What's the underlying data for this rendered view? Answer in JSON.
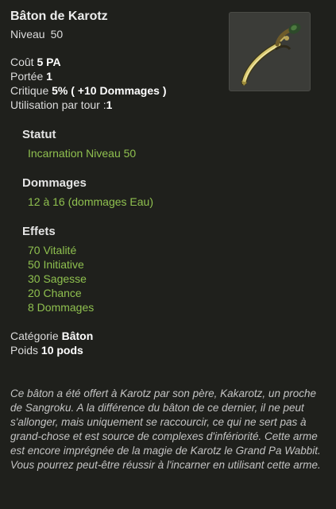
{
  "item": {
    "name": "Bâton de Karotz",
    "level_label": "Niveau",
    "level_value": "50",
    "image_icon": "staff-icon"
  },
  "stats": {
    "cost_label": "Coût",
    "cost_value": "5 PA",
    "range_label": "Portée",
    "range_value": "1",
    "critical_label": "Critique",
    "critical_value": "5% ( +10 Dommages )",
    "uses_label": "Utilisation par tour :",
    "uses_value": "1"
  },
  "status": {
    "title": "Statut",
    "value": "Incarnation Niveau 50"
  },
  "damage": {
    "title": "Dommages",
    "value": "12 à 16 (dommages Eau)"
  },
  "effects": {
    "title": "Effets",
    "items": [
      "70 Vitalité",
      "50 Initiative",
      "30 Sagesse",
      "20 Chance",
      "8 Dommages"
    ]
  },
  "meta": {
    "category_label": "Catégorie",
    "category_value": "Bâton",
    "weight_label": "Poids",
    "weight_value": "10 pods"
  },
  "description": "Ce bâton a été offert à Karotz par son père, Kakarotz, un proche de Sangroku. A la différence du bâton de ce dernier, il ne peut s'allonger, mais uniquement se raccourcir, ce qui ne sert pas à grand-chose et est source de complexes d'infériorité.  Cette arme est encore imprégnée de la magie de Karotz le Grand Pa Wabbit. Vous pourrez peut-être réussir à l'incarner en utilisant cette arme.",
  "colors": {
    "background": "#1f201c",
    "effect_green": "#8fc04f",
    "title_white": "#ececec"
  }
}
